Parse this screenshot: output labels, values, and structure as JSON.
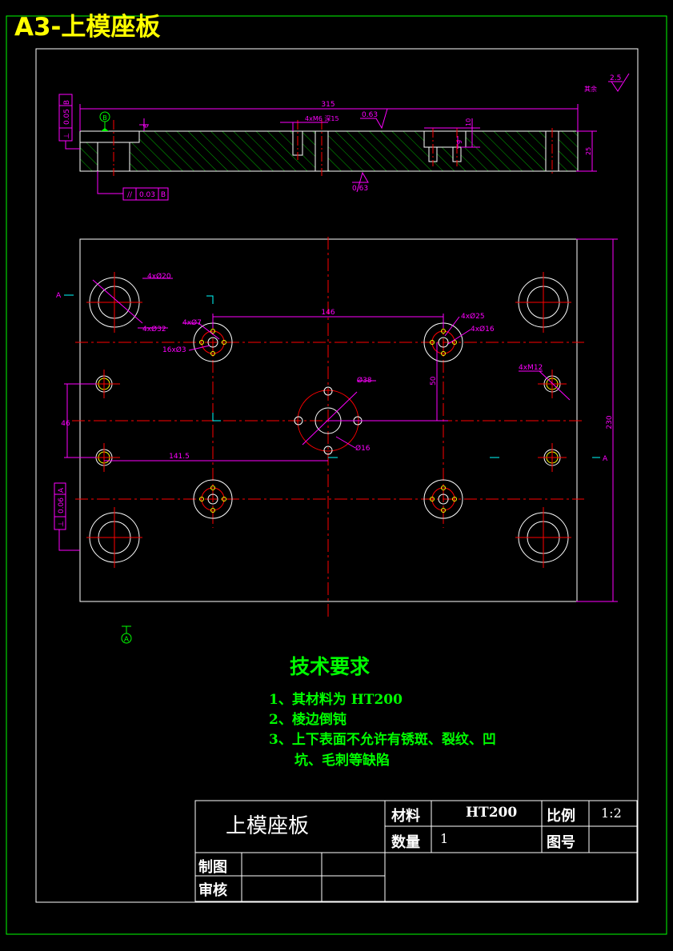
{
  "banner_title": "A3-上模座板",
  "dimensions": {
    "overall_length": "315",
    "thread_note": "4xM6 深15",
    "roughness_top": "0.63",
    "roughness_bottom": "0.63",
    "depth_10": "10",
    "depth_9": "9",
    "thickness_25": "25",
    "depth_6": "6",
    "default_roughness_label": "其余",
    "default_roughness_value": "2.5",
    "hole_4x20": "4xØ20",
    "hole_4x32": "4xØ32",
    "hole_4x7": "4xØ7",
    "hole_16x3": "16xØ3",
    "hole_4x25": "4xØ25",
    "hole_4x16": "4xØ16",
    "hole_4xM12": "4xM12",
    "spacing_146": "146",
    "spacing_50": "50",
    "spacing_46": "46",
    "spacing_141_5": "141.5",
    "height_230": "230",
    "center_38": "Ø38",
    "center_16": "Ø16",
    "section_a_left": "A",
    "section_a_right": "A",
    "datum_a": "A",
    "datum_b": "B"
  },
  "tolerances": {
    "perp_b": {
      "symbol": "⊥",
      "value": "0.05",
      "datum": "B"
    },
    "parallel_b": {
      "symbol": "//",
      "value": "0.03",
      "datum": "B"
    },
    "perp_a": {
      "symbol": "⊥",
      "value": "0.06",
      "datum": "A"
    }
  },
  "tech_requirements": {
    "title": "技术要求",
    "items": [
      "1、其材料为 HT200",
      "2、棱边倒钝",
      "3、上下表面不允许有锈斑、裂纹、凹",
      "坑、毛刺等缺陷"
    ]
  },
  "title_block": {
    "part_name": "上模座板",
    "material_label": "材料",
    "material_value": "HT200",
    "scale_label": "比例",
    "scale_value": "1:2",
    "quantity_label": "数量",
    "quantity_value": "1",
    "drawing_no_label": "图号",
    "drawn_label": "制图",
    "checked_label": "审核"
  },
  "colors": {
    "background": "#000000",
    "outline": "#ffffff",
    "dimension": "#ff00ff",
    "centerline": "#ff0000",
    "hatch": "#00ff00",
    "hidden": "#ffff00",
    "text_green": "#00ff00",
    "frame": "#00ff00",
    "section": "#00ffff"
  }
}
